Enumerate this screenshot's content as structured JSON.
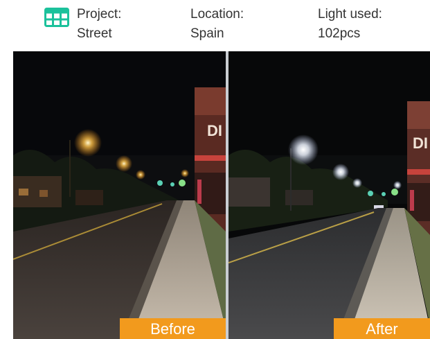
{
  "header": {
    "icon": "table-grid-icon",
    "icon_color": "#1bc19b",
    "project": {
      "label": "Project:",
      "value": "Street"
    },
    "location": {
      "label": "Location:",
      "value": "Spain"
    },
    "light": {
      "label": "Light used:",
      "value": "102pcs"
    }
  },
  "comparison": {
    "before_label": "Before",
    "after_label": "After",
    "label_color": "#f29a1d"
  }
}
